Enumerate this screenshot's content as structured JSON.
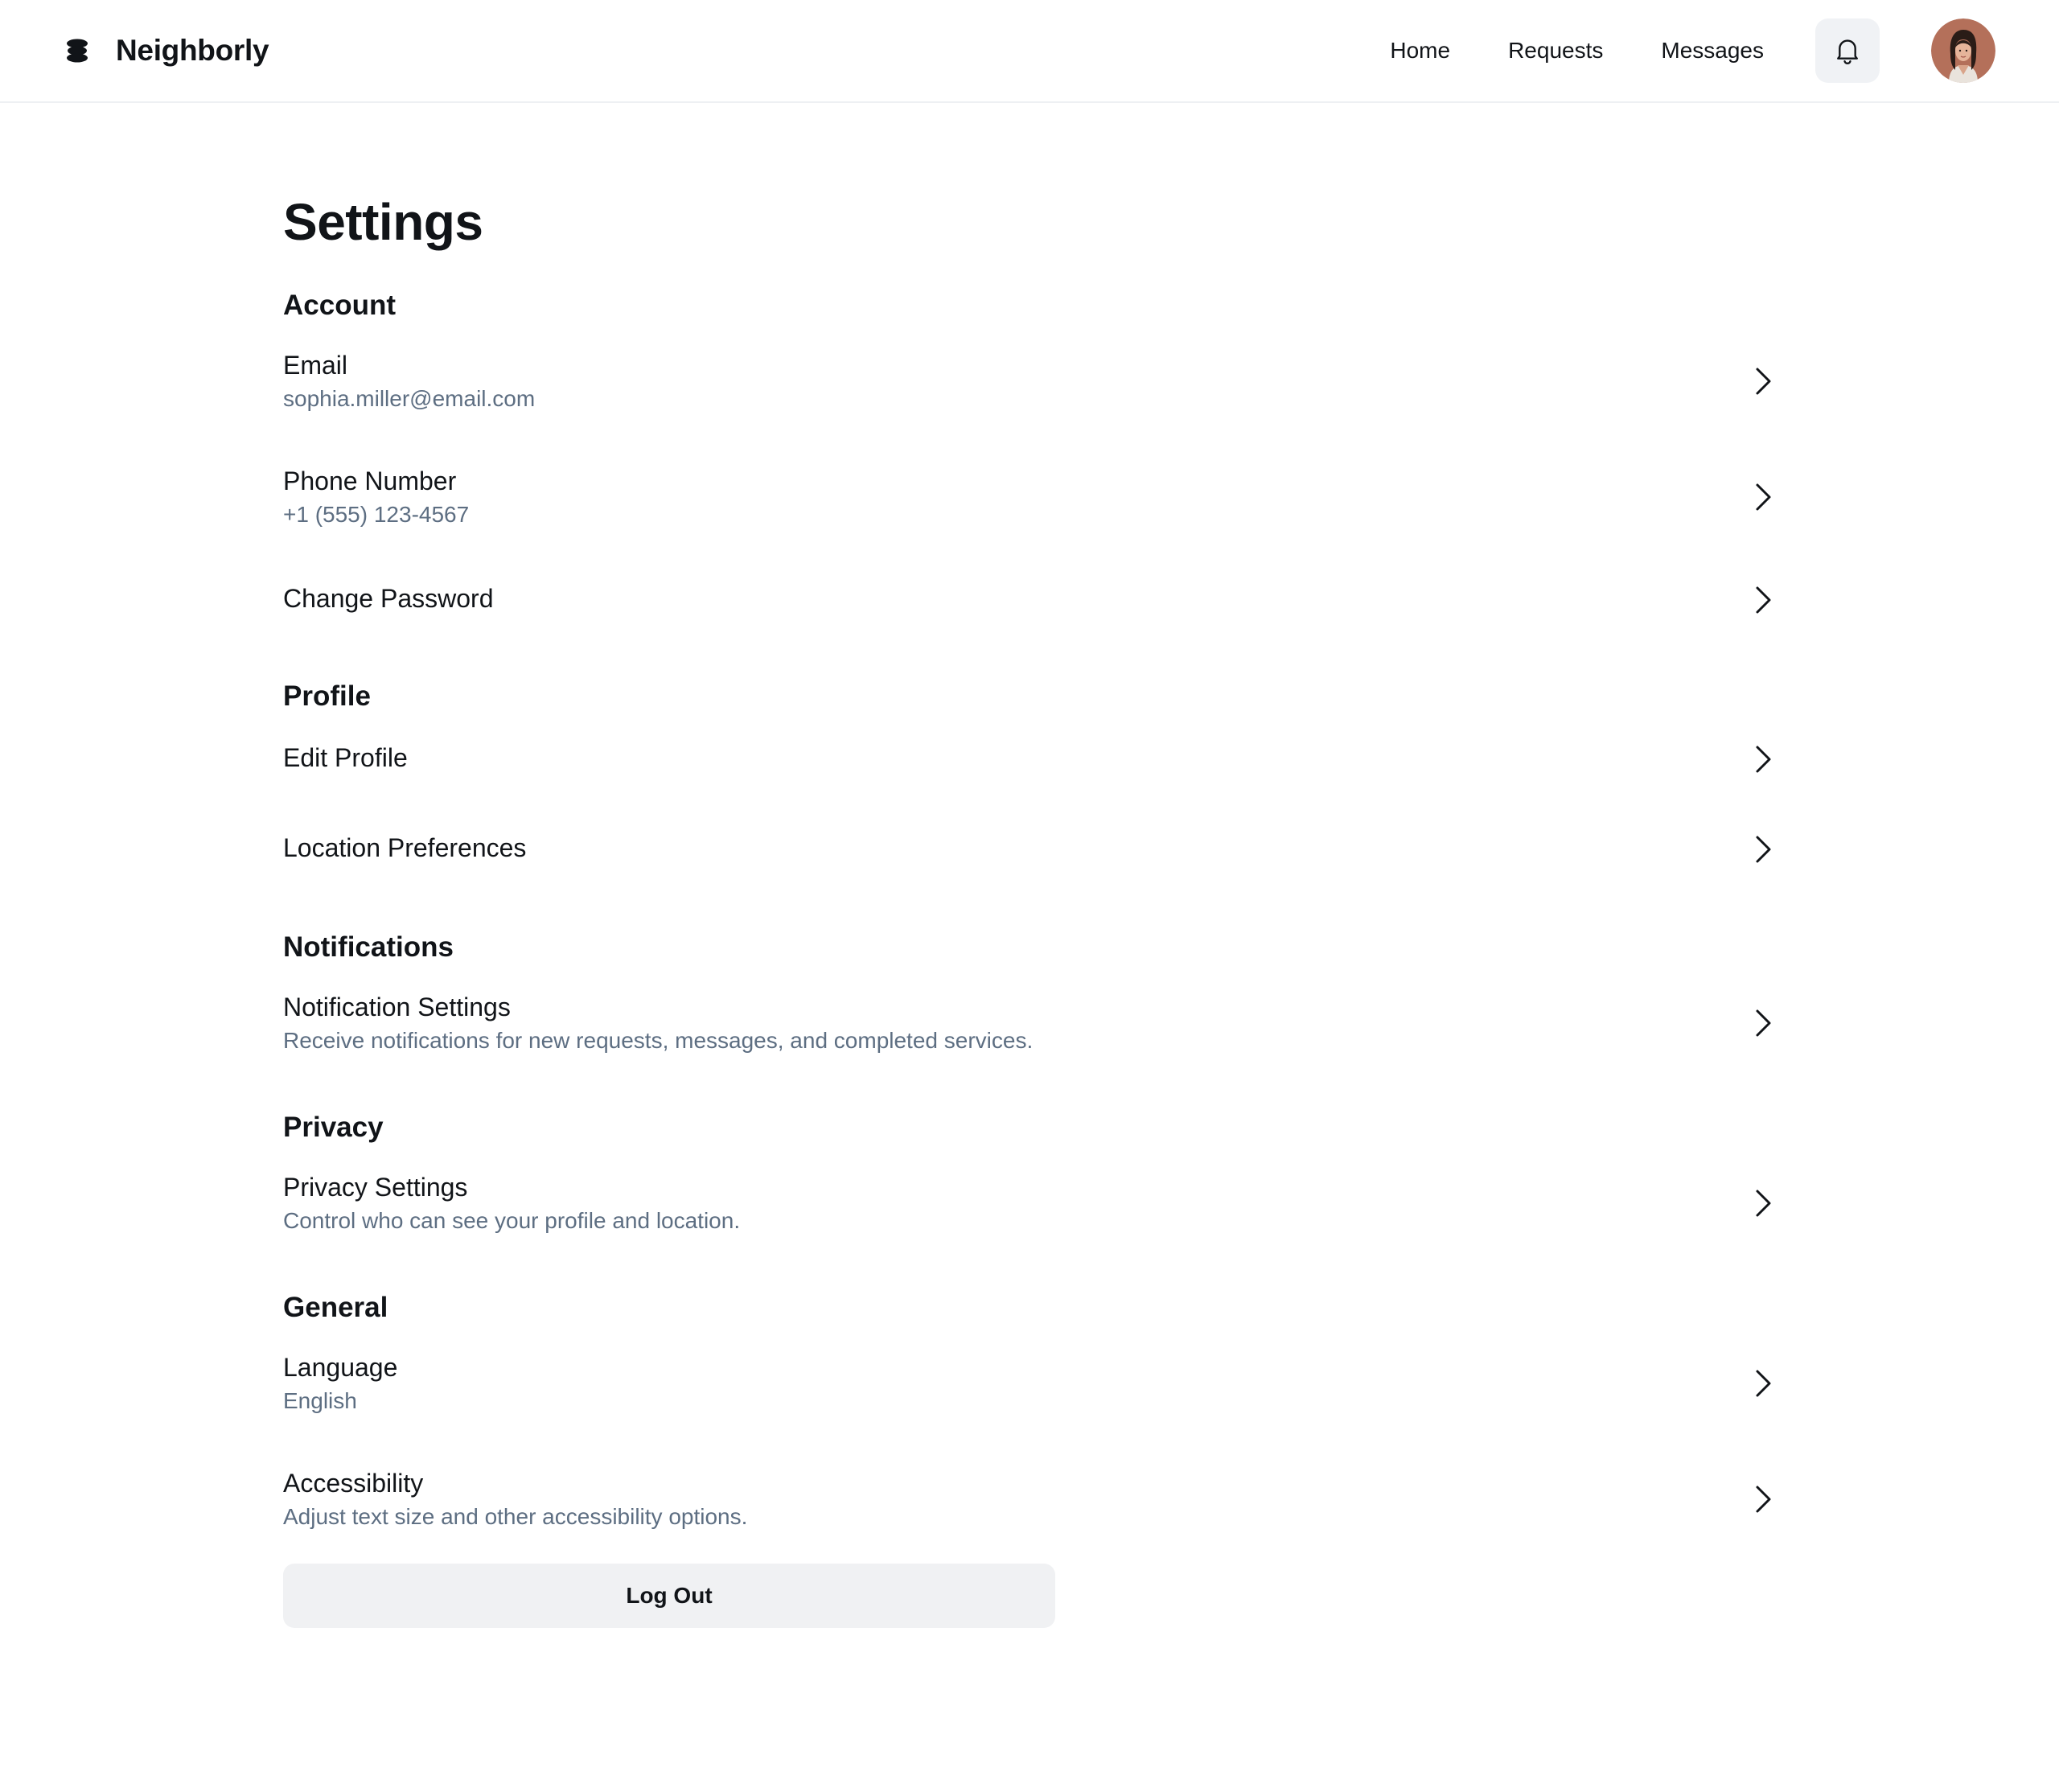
{
  "brand": {
    "name": "Neighborly"
  },
  "nav": {
    "links": [
      "Home",
      "Requests",
      "Messages"
    ]
  },
  "page": {
    "title": "Settings"
  },
  "sections": {
    "account": {
      "title": "Account",
      "items": [
        {
          "label": "Email",
          "value": "sophia.miller@email.com"
        },
        {
          "label": "Phone Number",
          "value": "+1 (555) 123-4567"
        },
        {
          "label": "Change Password"
        }
      ]
    },
    "profile": {
      "title": "Profile",
      "items": [
        {
          "label": "Edit Profile"
        },
        {
          "label": "Location Preferences"
        }
      ]
    },
    "notifications": {
      "title": "Notifications",
      "items": [
        {
          "label": "Notification Settings",
          "value": "Receive notifications for new requests, messages, and completed services."
        }
      ]
    },
    "privacy": {
      "title": "Privacy",
      "items": [
        {
          "label": "Privacy Settings",
          "value": "Control who can see your profile and location."
        }
      ]
    },
    "general": {
      "title": "General",
      "items": [
        {
          "label": "Language",
          "value": "English"
        },
        {
          "label": "Accessibility",
          "value": "Adjust text size and other accessibility options."
        }
      ]
    }
  },
  "actions": {
    "logout_label": "Log Out"
  },
  "icons": {
    "logo": "stacked-disc-logo-icon",
    "notifications": "bell-icon",
    "row_arrow": "chevron-right-icon",
    "avatar": "user-avatar"
  },
  "colors": {
    "text_primary": "#111418",
    "text_secondary": "#5d6e82",
    "button_bg": "#f0f1f3",
    "divider": "#eef0f3"
  }
}
